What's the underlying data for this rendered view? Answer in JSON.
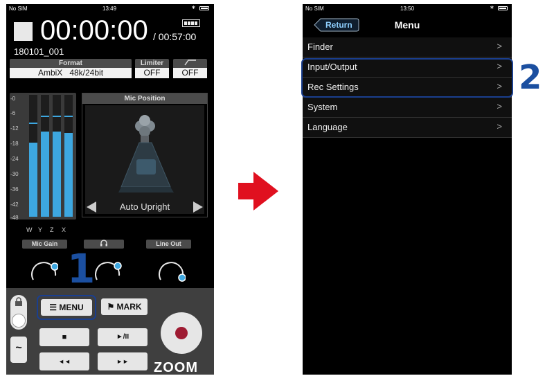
{
  "left_screen": {
    "status": {
      "carrier": "No SIM",
      "time": "13:49"
    },
    "counter": "00:00:00",
    "remaining": "/ 00:57:00",
    "file_name": "180101_001",
    "format": {
      "label": "Format",
      "value_format": "AmbiX",
      "value_rate": "48k/24bit"
    },
    "limiter": {
      "label": "Limiter",
      "value": "OFF"
    },
    "lowcut": {
      "value": "OFF"
    },
    "meter": {
      "scale": [
        "-0",
        "-6",
        "-12",
        "-18",
        "-24",
        "-30",
        "-36",
        "-42",
        "-48"
      ],
      "channels": [
        "W",
        "Y",
        "Z",
        "X"
      ],
      "levels": [
        0.61,
        0.7,
        0.7,
        0.69
      ],
      "peaks": [
        0.76,
        0.82,
        0.82,
        0.82
      ]
    },
    "mic_position": {
      "title": "Mic Position",
      "value": "Auto Upright"
    },
    "knobs": {
      "mic_gain": "Mic Gain",
      "line_out": "Line Out"
    },
    "buttons": {
      "menu": "MENU",
      "mark": "MARK",
      "stop": "■",
      "play_pause": "►/II",
      "rewind": "◄◄",
      "forward": "►►"
    },
    "logo": "ZOOM",
    "callout": "1"
  },
  "right_screen": {
    "status": {
      "carrier": "No SIM",
      "time": "13:50"
    },
    "return_label": "Return",
    "title": "Menu",
    "items": [
      {
        "label": "Finder"
      },
      {
        "label": "Input/Output"
      },
      {
        "label": "Rec Settings"
      },
      {
        "label": "System"
      },
      {
        "label": "Language"
      }
    ],
    "chevron": ">",
    "callout": "2"
  },
  "colors": {
    "accent_blue": "#1b4fa0",
    "meter_blue": "#3da7e0",
    "arrow_red": "#e0101f",
    "rec_red": "#9e1b32"
  }
}
